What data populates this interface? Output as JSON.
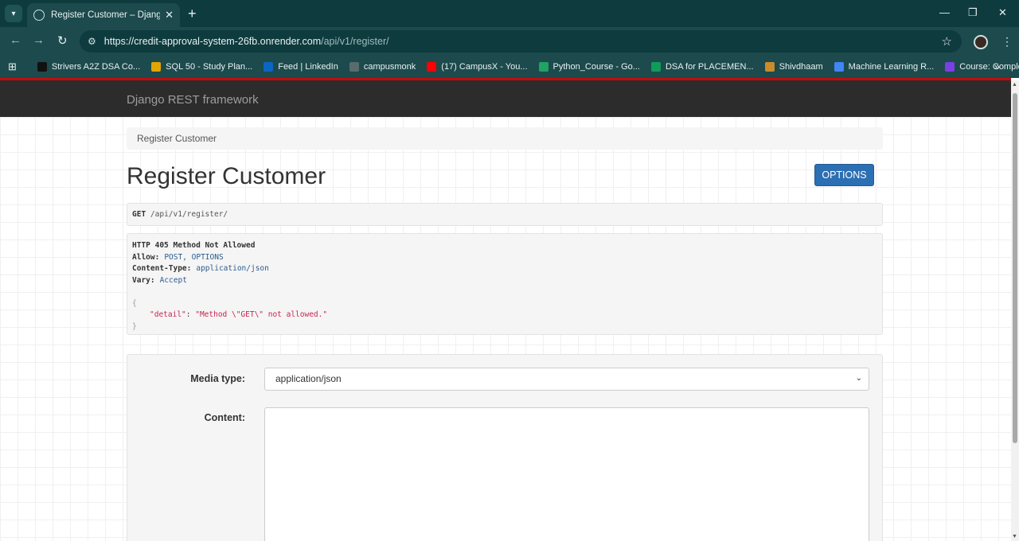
{
  "browser": {
    "tab_title": "Register Customer – Django RE",
    "url_host": "https://credit-approval-system-26fb.onrender.com",
    "url_path": "/api/v1/register/",
    "bookmarks": [
      {
        "label": "Strivers A2Z DSA Co...",
        "color": "#111111"
      },
      {
        "label": "SQL 50 - Study Plan...",
        "color": "#e0a500"
      },
      {
        "label": "Feed | LinkedIn",
        "color": "#0a66c2"
      },
      {
        "label": "campusmonk",
        "color": "#5a6b6c"
      },
      {
        "label": "(17) CampusX - You...",
        "color": "#ff0000"
      },
      {
        "label": "Python_Course - Go...",
        "color": "#1fa463"
      },
      {
        "label": "DSA for PLACEMEN...",
        "color": "#0f9d58"
      },
      {
        "label": "Shivdhaam",
        "color": "#c98b2b"
      },
      {
        "label": "Machine Learning R...",
        "color": "#4285f4"
      },
      {
        "label": "Course: Complete P...",
        "color": "#7b3fe4"
      }
    ]
  },
  "navbar": {
    "brand": "Django REST framework"
  },
  "breadcrumb": "Register Customer",
  "page_title": "Register Customer",
  "options_button": "OPTIONS",
  "request": {
    "method": "GET",
    "path": "/api/v1/register/"
  },
  "response": {
    "status": "HTTP 405 Method Not Allowed",
    "headers": [
      {
        "key": "Allow:",
        "value": "POST, OPTIONS"
      },
      {
        "key": "Content-Type:",
        "value": "application/json"
      },
      {
        "key": "Vary:",
        "value": "Accept"
      }
    ],
    "open_brace": "{",
    "body_key": "\"detail\"",
    "body_sep": ": ",
    "body_value": "\"Method \\\"GET\\\" not allowed.\"",
    "close_brace": "}"
  },
  "form": {
    "media_type_label": "Media type:",
    "media_type_value": "application/json",
    "content_label": "Content:"
  }
}
